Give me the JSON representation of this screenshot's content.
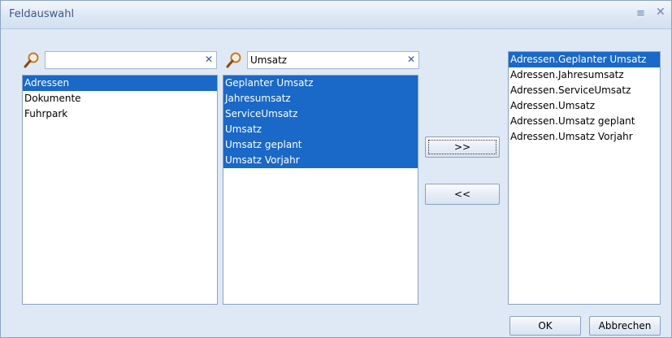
{
  "window": {
    "title": "Feldauswahl",
    "pin_glyph": "≡",
    "close_glyph": "✕"
  },
  "left_panel": {
    "search": {
      "value": "",
      "placeholder": "",
      "clear_glyph": "✕"
    },
    "items": [
      {
        "label": "Adressen",
        "selected": true
      },
      {
        "label": "Dokumente",
        "selected": false
      },
      {
        "label": "Fuhrpark",
        "selected": false
      }
    ]
  },
  "middle_panel": {
    "search": {
      "value": "Umsatz",
      "placeholder": "",
      "clear_glyph": "✕"
    },
    "items": [
      {
        "label": "Geplanter Umsatz",
        "selected": true
      },
      {
        "label": "Jahresumsatz",
        "selected": true
      },
      {
        "label": "ServiceUmsatz",
        "selected": true
      },
      {
        "label": "Umsatz",
        "selected": true
      },
      {
        "label": "Umsatz geplant",
        "selected": true
      },
      {
        "label": "Umsatz Vorjahr",
        "selected": true
      }
    ]
  },
  "transfer": {
    "add_label": ">>",
    "remove_label": "<<"
  },
  "right_panel": {
    "items": [
      {
        "label": "Adressen.Geplanter Umsatz",
        "selected": true
      },
      {
        "label": "Adressen.Jahresumsatz",
        "selected": false
      },
      {
        "label": "Adressen.ServiceUmsatz",
        "selected": false
      },
      {
        "label": "Adressen.Umsatz",
        "selected": false
      },
      {
        "label": "Adressen.Umsatz geplant",
        "selected": false
      },
      {
        "label": "Adressen.Umsatz Vorjahr",
        "selected": false
      }
    ]
  },
  "footer": {
    "ok_label": "OK",
    "cancel_label": "Abbrechen"
  }
}
